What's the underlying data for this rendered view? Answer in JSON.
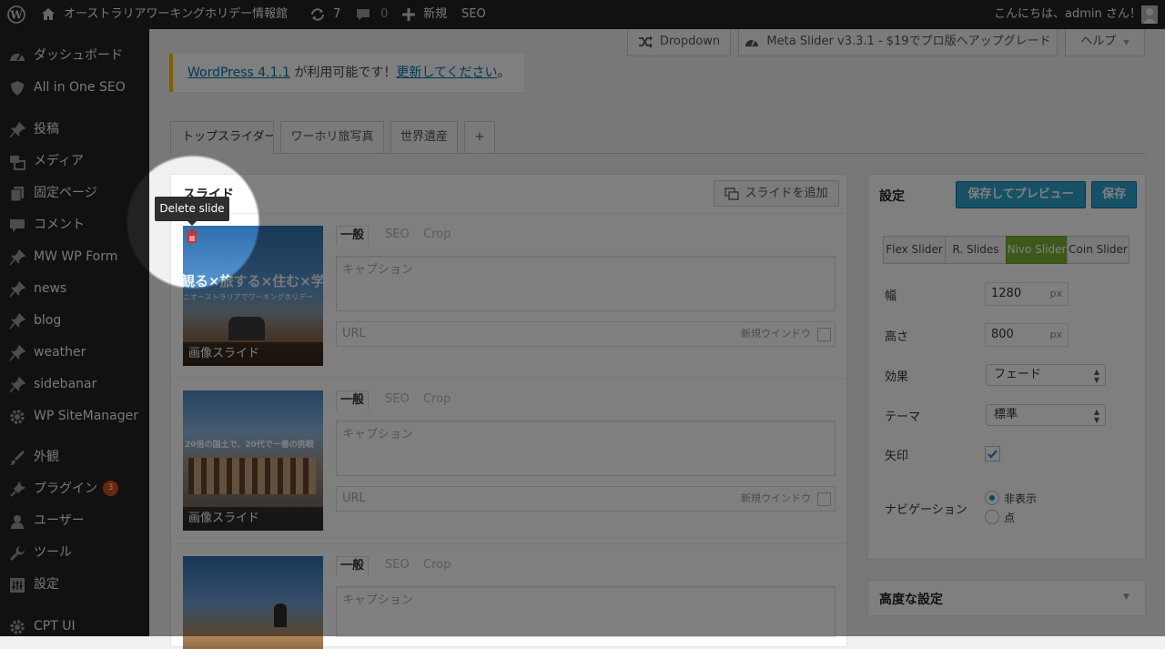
{
  "admin_bar": {
    "site_name": "オーストラリアワーキングホリデー情報館",
    "updates_count": "7",
    "comments_count": "0",
    "new_label": "新規",
    "seo_label": "SEO",
    "greeting": "こんにちは、admin さん！"
  },
  "sidebar": {
    "items": [
      {
        "label": "ダッシュボード",
        "icon": "dashboard-icon"
      },
      {
        "label": "All in One SEO",
        "icon": "shield-icon"
      },
      {
        "label": "投稿",
        "icon": "pin-icon"
      },
      {
        "label": "メディア",
        "icon": "media-icon"
      },
      {
        "label": "固定ページ",
        "icon": "page-icon"
      },
      {
        "label": "コメント",
        "icon": "comment-icon"
      },
      {
        "label": "MW WP Form",
        "icon": "pin-icon"
      },
      {
        "label": "news",
        "icon": "pin-icon"
      },
      {
        "label": "blog",
        "icon": "pin-icon"
      },
      {
        "label": "weather",
        "icon": "pin-icon"
      },
      {
        "label": "sidebanar",
        "icon": "pin-icon"
      },
      {
        "label": "WP SiteManager",
        "icon": "gear-icon"
      },
      {
        "label": "外観",
        "icon": "brush-icon"
      },
      {
        "label": "プラグイン",
        "icon": "plugin-icon",
        "badge": "3"
      },
      {
        "label": "ユーザー",
        "icon": "user-icon"
      },
      {
        "label": "ツール",
        "icon": "wrench-icon"
      },
      {
        "label": "設定",
        "icon": "settings-icon"
      },
      {
        "label": "CPT UI",
        "icon": "gear-icon"
      }
    ]
  },
  "top_buttons": {
    "dropdown": "Dropdown",
    "meta_slider": "Meta Slider v3.3.1 - $19でプロ版へアップグレード",
    "help": "ヘルプ"
  },
  "notice": {
    "link1": "WordPress 4.1.1",
    "text": " が利用可能です！",
    "link2": "更新してください",
    "end": "。"
  },
  "slider_tabs": [
    "トップスライダー",
    "ワーホリ旅写真",
    "世界遺産",
    "+"
  ],
  "slides_box": {
    "title": "スライド",
    "add_button": "スライドを追加",
    "tooltip": "Delete slide"
  },
  "slides": [
    {
      "tab_general": "一般",
      "tab_seo": "SEO",
      "tab_crop": "Crop",
      "caption_placeholder": "キャプション",
      "url_placeholder": "URL",
      "new_window": "新規ウインドウ",
      "thumb_caption": "画像スライド",
      "banner": "観る×旅する×住む×学ぶ",
      "banner_sub": "ニオーストラリアでワーキングホリデー"
    },
    {
      "tab_general": "一般",
      "tab_seo": "SEO",
      "tab_crop": "Crop",
      "caption_placeholder": "キャプション",
      "url_placeholder": "URL",
      "new_window": "新規ウインドウ",
      "thumb_caption": "画像スライド",
      "banner": "20倍の国土で、20代で一番の挑戦"
    },
    {
      "tab_general": "一般",
      "tab_seo": "SEO",
      "tab_crop": "Crop",
      "caption_placeholder": "キャプション"
    }
  ],
  "settings": {
    "title": "設定",
    "save_preview": "保存してプレビュー",
    "save": "保存",
    "slider_types": [
      "Flex Slider",
      "R. Slides",
      "Nivo Slider",
      "Coin Slider"
    ],
    "active_type": "Nivo Slider",
    "width_label": "幅",
    "width_value": "1280",
    "unit": "px",
    "height_label": "高さ",
    "height_value": "800",
    "effect_label": "効果",
    "effect_value": "フェード",
    "theme_label": "テーマ",
    "theme_value": "標準",
    "arrows_label": "矢印",
    "nav_label": "ナビゲーション",
    "nav_options": [
      "非表示",
      "点"
    ],
    "nav_selected": "非表示"
  },
  "advanced": {
    "title": "高度な設定"
  },
  "colors": {
    "accent_blue": "#2ea2cc",
    "active_green": "#7ab232",
    "notice_yellow": "#ffba00",
    "delete_red": "#e0281e"
  }
}
